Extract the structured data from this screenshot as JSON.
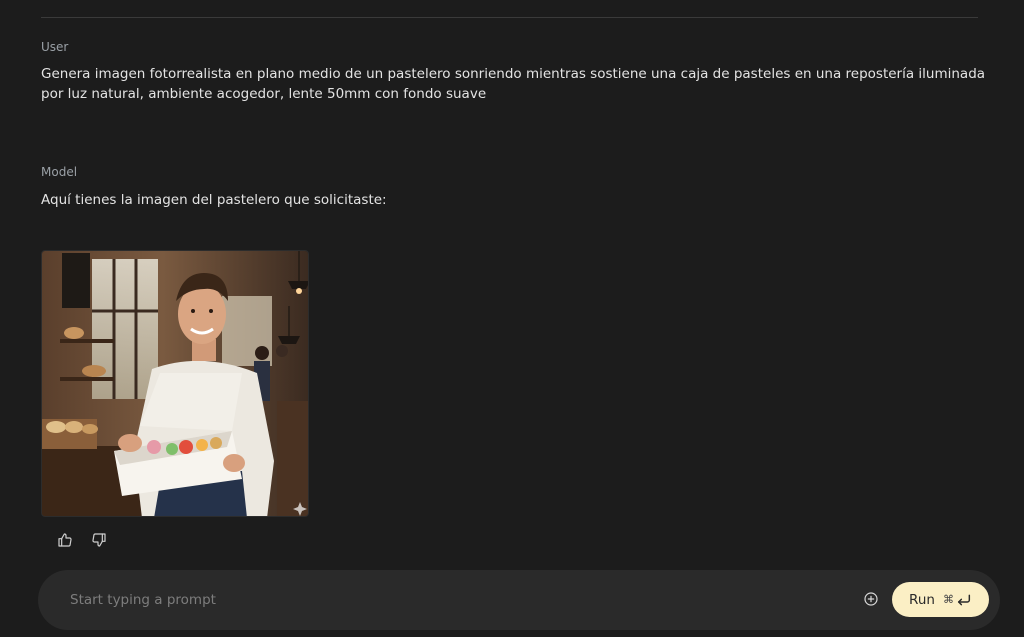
{
  "conversation": {
    "user": {
      "role_label": "User",
      "text": "Genera imagen fotorrealista en plano medio de un pastelero sonriendo mientras sostiene una caja de pasteles en una repostería iluminada por luz natural, ambiente acogedor, lente 50mm con fondo suave"
    },
    "model": {
      "role_label": "Model",
      "text": "Aquí tienes la imagen del pastelero que solicitaste:",
      "image": {
        "subject": "pastry-chef-holding-cake-box"
      }
    }
  },
  "feedback": {
    "thumbs_up_icon": "thumbs-up-icon",
    "thumbs_down_icon": "thumbs-down-icon"
  },
  "prompt_bar": {
    "placeholder": "Start typing a prompt",
    "add_icon": "plus-circle-icon",
    "run_label": "Run",
    "run_shortcut": "⌘",
    "run_shortcut_icon": "enter-arrow-icon"
  },
  "colors": {
    "background": "#1c1c1c",
    "prompt_bar": "#2a2a2a",
    "run_button": "#fbefc5"
  }
}
